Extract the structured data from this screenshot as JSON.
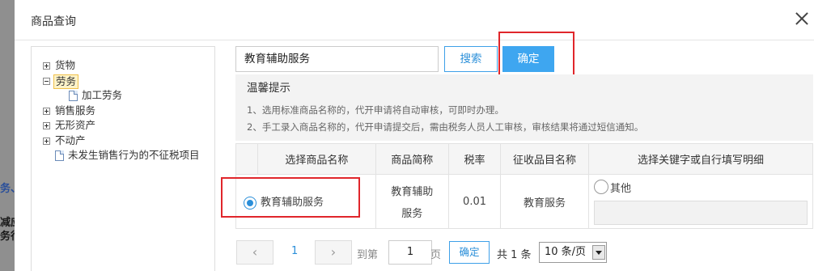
{
  "background": {
    "frag1": "务、",
    "frag2": "减应",
    "frag3": "务行"
  },
  "dialog": {
    "title": "商品查询"
  },
  "tree": {
    "items": [
      {
        "label": "货物",
        "expander": "plus"
      },
      {
        "label": "劳务",
        "expander": "minus",
        "selected": true
      },
      {
        "label": "加工劳务",
        "expander": "none"
      },
      {
        "label": "销售服务",
        "expander": "plus"
      },
      {
        "label": "无形资产",
        "expander": "plus"
      },
      {
        "label": "不动产",
        "expander": "plus"
      },
      {
        "label": "未发生销售行为的不征税项目",
        "expander": "none"
      }
    ]
  },
  "search": {
    "value": "教育辅助服务",
    "search_label": "搜索",
    "confirm_label": "确定"
  },
  "tips": {
    "title": "温馨提示",
    "line1": "1、选用标准商品名称的，代开申请将自动审核，可即时办理。",
    "line2": "2、手工录入商品名称的，代开申请提交后，需由税务人员人工审核，审核结果将通过短信通知。"
  },
  "table": {
    "headers": [
      "选择商品名称",
      "商品简称",
      "税率",
      "征收品目名称",
      "选择关键字或自行填写明细"
    ],
    "rows": [
      {
        "selected": true,
        "name": "教育辅助服务",
        "short_name_line1": "教育辅助",
        "short_name_line2": "服务",
        "rate": "0.01",
        "category": "教育服务",
        "other_label": "其他"
      }
    ]
  },
  "pager": {
    "prev": "‹",
    "next": "›",
    "page": "1",
    "goto_label": "到第",
    "page_input": "1",
    "page_unit": "页",
    "go_label": "确定",
    "total": "共 1 条",
    "page_size": "10 条/页"
  },
  "colors": {
    "accent": "#3ea6f0",
    "highlight": "#e0262b"
  }
}
